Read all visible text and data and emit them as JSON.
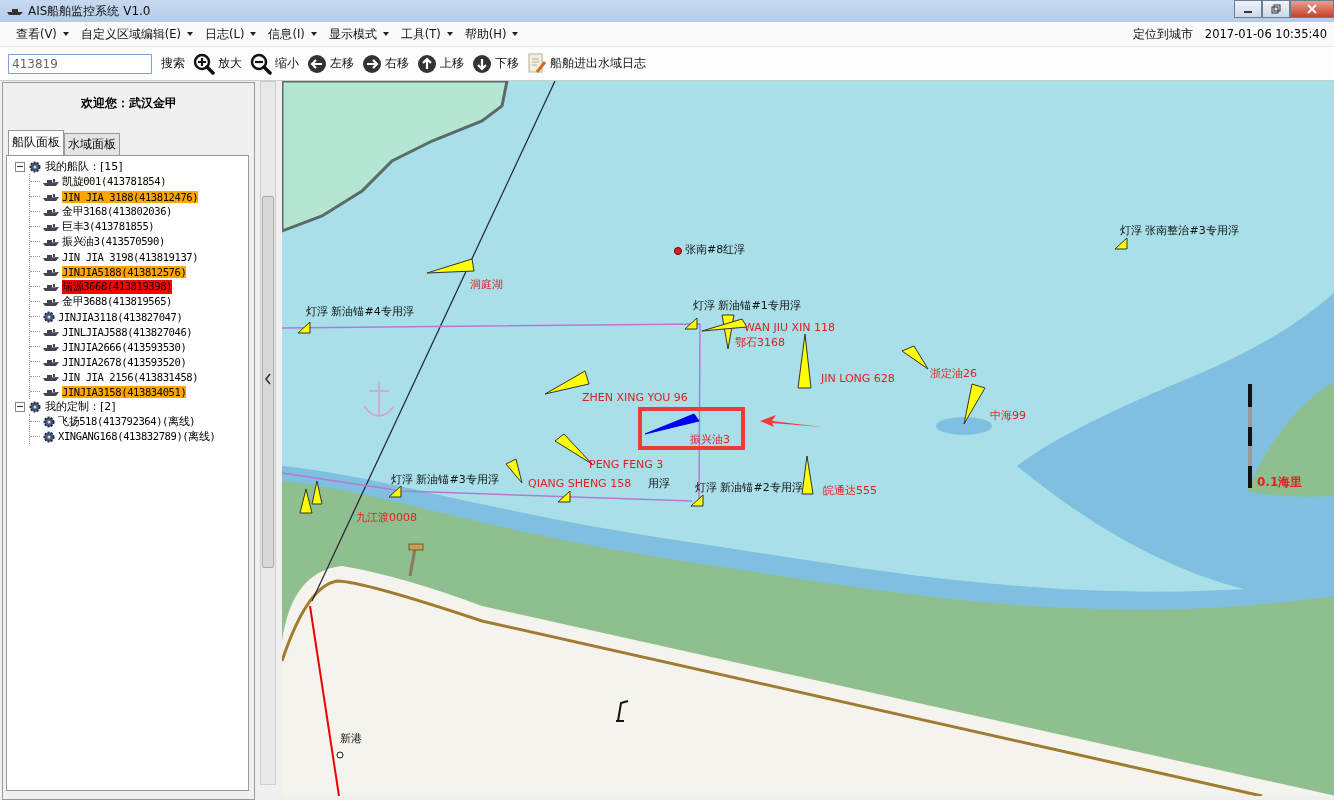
{
  "window": {
    "title": "AIS船舶监控系统 V1.0"
  },
  "menu": [
    {
      "label": "查看(V)"
    },
    {
      "label": "自定义区域编辑(E)"
    },
    {
      "label": "日志(L)"
    },
    {
      "label": "信息(I)"
    },
    {
      "label": "显示模式"
    },
    {
      "label": "工具(T)"
    },
    {
      "label": "帮助(H)"
    }
  ],
  "status": {
    "locate": "定位到城市",
    "datetime": "2017-01-06 10:35:40"
  },
  "toolbar": {
    "search_value": "413819",
    "search_button": "搜索",
    "tools": [
      {
        "kind": "zoom-in",
        "label": "放大"
      },
      {
        "kind": "zoom-out",
        "label": "缩小"
      },
      {
        "kind": "left",
        "label": "左移"
      },
      {
        "kind": "right",
        "label": "右移"
      },
      {
        "kind": "up",
        "label": "上移"
      },
      {
        "kind": "down",
        "label": "下移"
      },
      {
        "kind": "log",
        "label": "船舶进出水域日志"
      }
    ]
  },
  "sidebar": {
    "welcome": "欢迎您：武汉金甲",
    "tabs": [
      {
        "label": "船队面板",
        "selected": true
      },
      {
        "label": "水域面板",
        "selected": false
      }
    ],
    "tree": [
      {
        "label": "我的船队：[15]",
        "expanded": true,
        "children": [
          {
            "kind": "ship",
            "label": "凯旋001(413781854)"
          },
          {
            "kind": "ship",
            "label": "JIN JIA 3188(413812476)",
            "color": "#ffa500"
          },
          {
            "kind": "ship",
            "label": "金甲3168(413802036)"
          },
          {
            "kind": "ship",
            "label": "巨丰3(413781855)"
          },
          {
            "kind": "ship",
            "label": "振兴油3(413570590)"
          },
          {
            "kind": "ship",
            "label": "JIN  JIA  3198(413819137)"
          },
          {
            "kind": "ship",
            "label": "JINJIA5188(413812576)",
            "color": "#ffa500"
          },
          {
            "kind": "ship",
            "label": "瑞源3668(413819398)",
            "color": "#ff0000"
          },
          {
            "kind": "ship",
            "label": "金甲3688(413819565)"
          },
          {
            "kind": "gear",
            "label": "JINJIA3118(413827047)"
          },
          {
            "kind": "ship",
            "label": "JINLJIAJ588(413827046)"
          },
          {
            "kind": "ship",
            "label": "JINJIA2666(413593530)"
          },
          {
            "kind": "ship",
            "label": "JINJIA2678(413593520)"
          },
          {
            "kind": "ship",
            "label": "JIN JIA 2156(413831458)"
          },
          {
            "kind": "ship",
            "label": "JINJIA3158(413834051)",
            "color": "#ffa500"
          }
        ]
      },
      {
        "label": "我的定制：[2]",
        "expanded": true,
        "children": [
          {
            "kind": "gear",
            "label": "飞扬518(413792364)(离线)"
          },
          {
            "kind": "gear",
            "label": "XINGANG168(413832789)(离线)"
          }
        ]
      }
    ]
  },
  "map": {
    "buoys": [
      {
        "kind": "light",
        "label": "灯浮 张南整治#3专用浮"
      },
      {
        "kind": "red",
        "label": "张南#8红浮"
      },
      {
        "kind": "light",
        "label": "灯浮 新油锚#4专用浮"
      },
      {
        "kind": "light",
        "label": "灯浮 新油锚#1专用浮"
      },
      {
        "kind": "light",
        "label": "灯浮 新油锚#3专用浮"
      },
      {
        "kind": "light",
        "label": "用浮"
      },
      {
        "kind": "light",
        "label": "灯浮 新油锚#2专用浮"
      }
    ],
    "vessels": [
      {
        "name": "洞庭湖",
        "selected": false
      },
      {
        "name": "WAN JIU XIN 118",
        "selected": false
      },
      {
        "name": "鄂石3168",
        "selected": false
      },
      {
        "name": "JIN LONG 628",
        "selected": false
      },
      {
        "name": "浙定油26",
        "selected": false
      },
      {
        "name": "中海99",
        "selected": false
      },
      {
        "name": "ZHEN XING YOU 96",
        "selected": false
      },
      {
        "name": "振兴油3",
        "selected": true
      },
      {
        "name": "PENG FENG 3",
        "selected": false
      },
      {
        "name": "QIANG SHENG 158",
        "selected": false
      },
      {
        "name": "皖通达555",
        "selected": false
      },
      {
        "name": "九江渡0008",
        "selected": false
      }
    ],
    "place": "新港",
    "scale": "0.1海里"
  }
}
